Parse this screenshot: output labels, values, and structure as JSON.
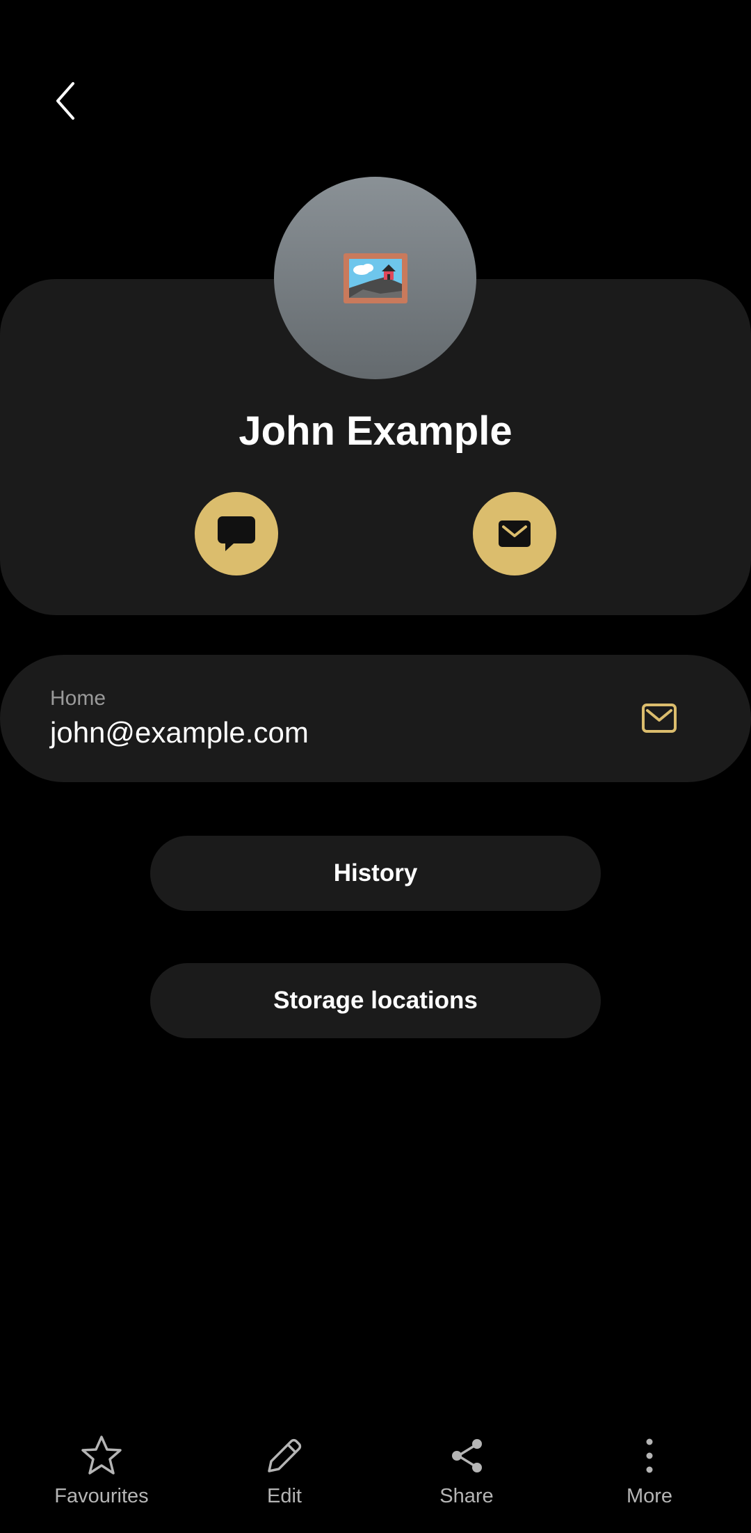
{
  "contact": {
    "name": "John Example"
  },
  "email": {
    "type_label": "Home",
    "address": "john@example.com"
  },
  "buttons": {
    "history": "History",
    "storage": "Storage locations"
  },
  "bottom_nav": {
    "favourites": "Favourites",
    "edit": "Edit",
    "share": "Share",
    "more": "More"
  },
  "colors": {
    "background": "#000000",
    "card": "#1b1b1b",
    "accent": "#dbbd6d",
    "secondary_text": "#9a9a9a"
  },
  "icons": {
    "back": "chevron-left-icon",
    "avatar": "framed-picture-icon",
    "message": "message-bubble-icon",
    "email": "envelope-icon",
    "favourites": "star-icon",
    "edit": "pencil-icon",
    "share": "share-icon",
    "more": "more-vertical-icon"
  }
}
